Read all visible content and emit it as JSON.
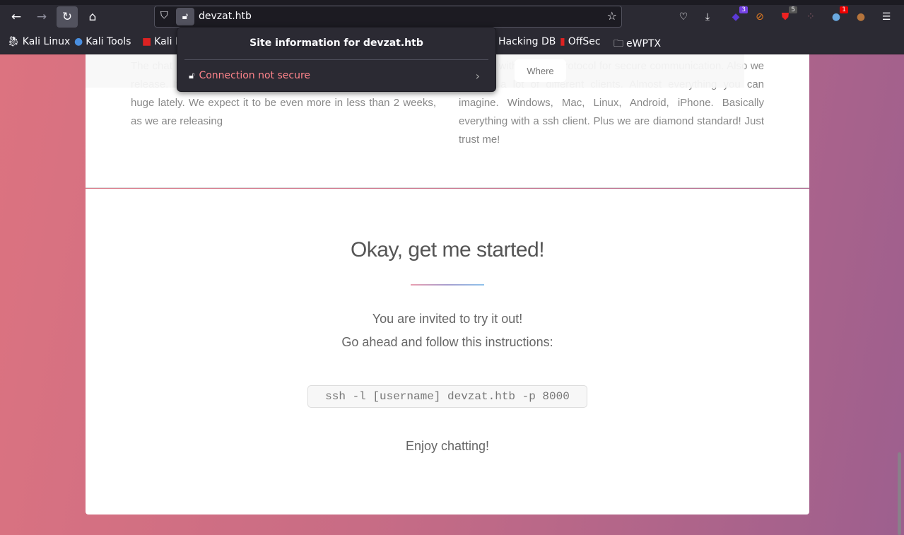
{
  "browser": {
    "url": "devzat.htb",
    "extensions": [
      {
        "name": "ext-stack",
        "badge": "3",
        "color": "#7542e5"
      },
      {
        "name": "ext-blocked",
        "badge": ""
      },
      {
        "name": "ext-shield",
        "badge": "5",
        "color": "#555"
      },
      {
        "name": "ext-dots",
        "badge": ""
      },
      {
        "name": "ext-globe",
        "badge": "1",
        "color": "#e00"
      },
      {
        "name": "ext-cookie",
        "badge": ""
      }
    ],
    "bookmarks": [
      {
        "label": "Kali Linux"
      },
      {
        "label": "Kali Tools"
      },
      {
        "label": "Kali Docs"
      },
      {
        "label": "Hacking DB"
      },
      {
        "label": "OffSec"
      },
      {
        "label": "eWPTX"
      }
    ]
  },
  "popup": {
    "title": "Site information for devzat.htb",
    "connection": "Connection not secure"
  },
  "page": {
    "nav_where": "Where",
    "left_text": "The chat is written in go and is a blazing fast, reliable and stable release. It can be run from a single executable. User growth is huge lately. We expect it to be even more in less than 2 weeks, as we are releasing",
    "right_text": "It works with the ssh protocol for secure communication. Also we support a lot of different clients. Almost everything you can imagine. Windows, Mac, Linux, Android, iPhone. Basically everything with a ssh client. Plus we are diamond standard! Just trust me!",
    "heading": "Okay, get me started!",
    "line1": "You are invited to try it out!",
    "line2": "Go ahead and follow this instructions:",
    "command": "ssh -l [username] devzat.htb -p 8000",
    "closing": "Enjoy chatting!"
  }
}
